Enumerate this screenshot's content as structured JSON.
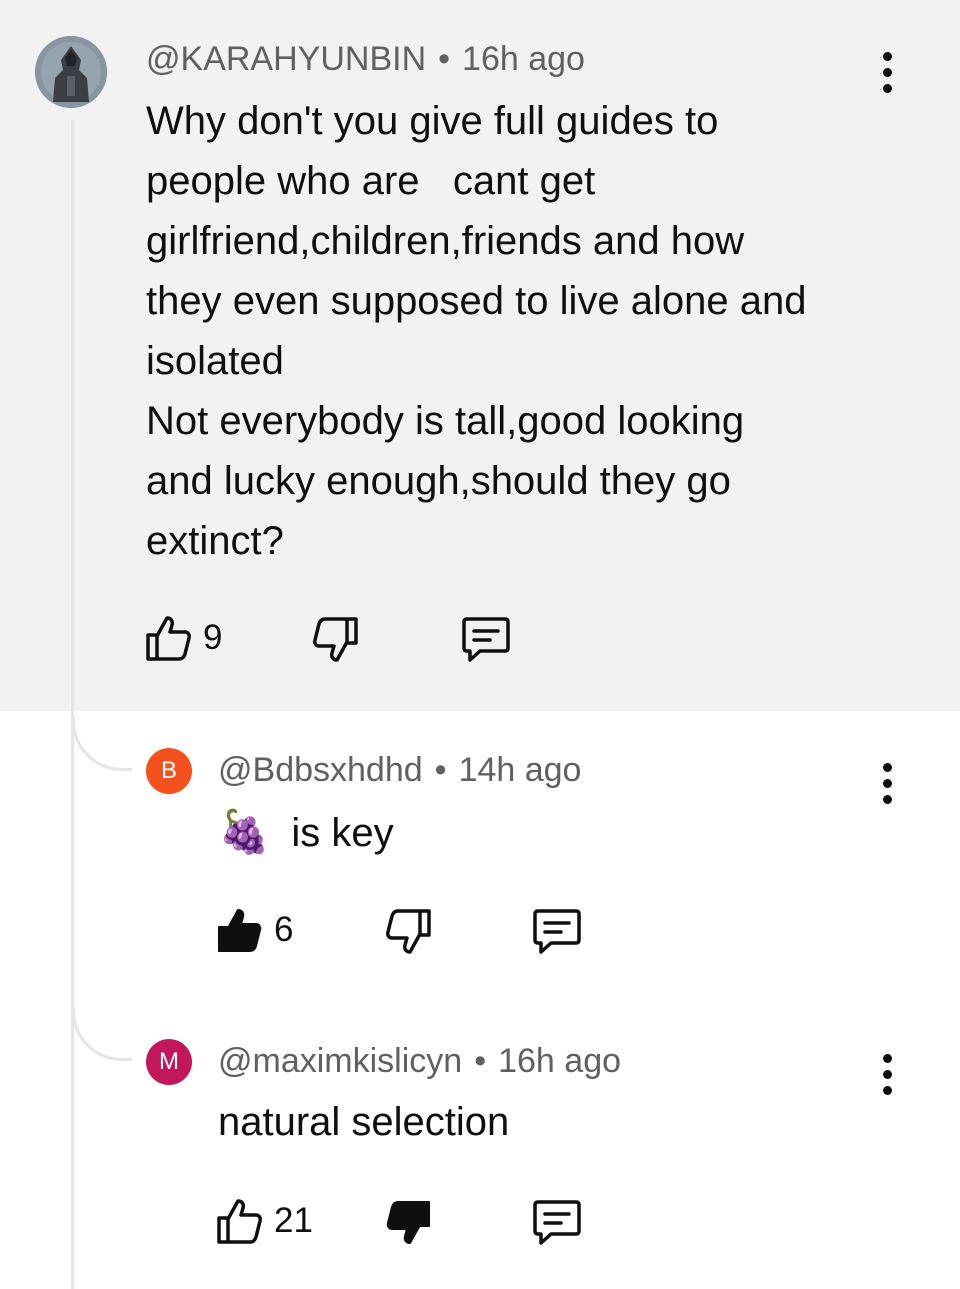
{
  "comments": [
    {
      "username": "@KARAHYUNBIN",
      "separator": "•",
      "time": "16h ago",
      "lines": [
        "Why don't you give full guides to",
        "people who are   cant get",
        "girlfriend,children,friends and how",
        "they even supposed to live alone and",
        "isolated",
        "Not everybody is tall,good looking",
        "and lucky enough,should they go",
        "extinct?"
      ],
      "likes": "9",
      "liked": false,
      "disliked": false
    }
  ],
  "replies": [
    {
      "avatar_letter": "B",
      "avatar_color": "#f4511e",
      "username": "@Bdbsxhdhd",
      "separator": "•",
      "time": "14h ago",
      "emoji": "🍇",
      "text": "is key",
      "likes": "6",
      "liked": true,
      "disliked": false
    },
    {
      "avatar_letter": "M",
      "avatar_color": "#c2185b",
      "username": "@maximkislicyn",
      "separator": "•",
      "time": "16h ago",
      "text": "natural selection",
      "likes": "21",
      "liked": false,
      "disliked": true
    }
  ],
  "icons": {
    "like": "thumbs-up-icon",
    "dislike": "thumbs-down-icon",
    "reply": "reply-comment-icon",
    "more": "more-vertical-icon"
  }
}
